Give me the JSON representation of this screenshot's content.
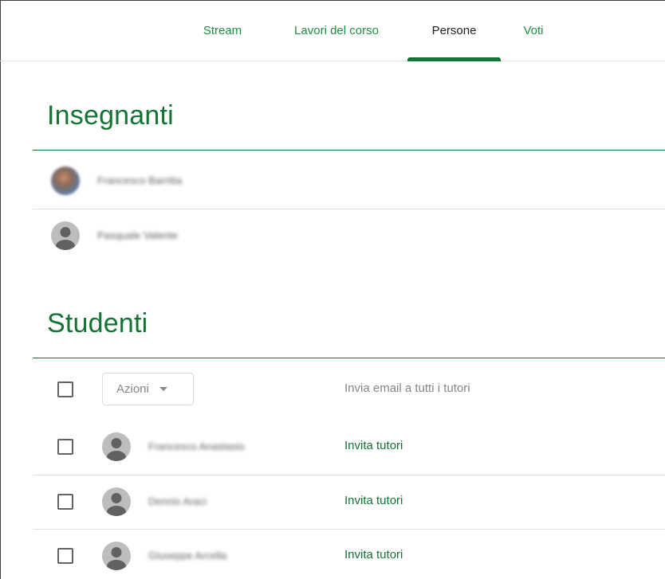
{
  "nav": {
    "tabs": [
      {
        "label": "Stream"
      },
      {
        "label": "Lavori del corso"
      },
      {
        "label": "Persone"
      },
      {
        "label": "Voti"
      }
    ],
    "active_tab": "Persone"
  },
  "teachers": {
    "title": "Insegnanti",
    "people": [
      {
        "name": "Francesco Barritta",
        "avatar": "photo"
      },
      {
        "name": "Pasquale Valente",
        "avatar": "default-person-icon"
      }
    ]
  },
  "students": {
    "title": "Studenti",
    "actions_label": "Azioni",
    "email_all_label": "Invia email a tutti i tutori",
    "people": [
      {
        "name": "Francesco Anastasio",
        "invite_label": "Invita tutori"
      },
      {
        "name": "Dennis Araci",
        "invite_label": "Invita tutori"
      },
      {
        "name": "Giuseppe Arcella",
        "invite_label": "Invita tutori"
      }
    ]
  },
  "colors": {
    "accent": "#137333",
    "tab_text": "#1e8e3e",
    "muted_text": "#80868b",
    "avatar_bg": "#bdbdbd"
  }
}
